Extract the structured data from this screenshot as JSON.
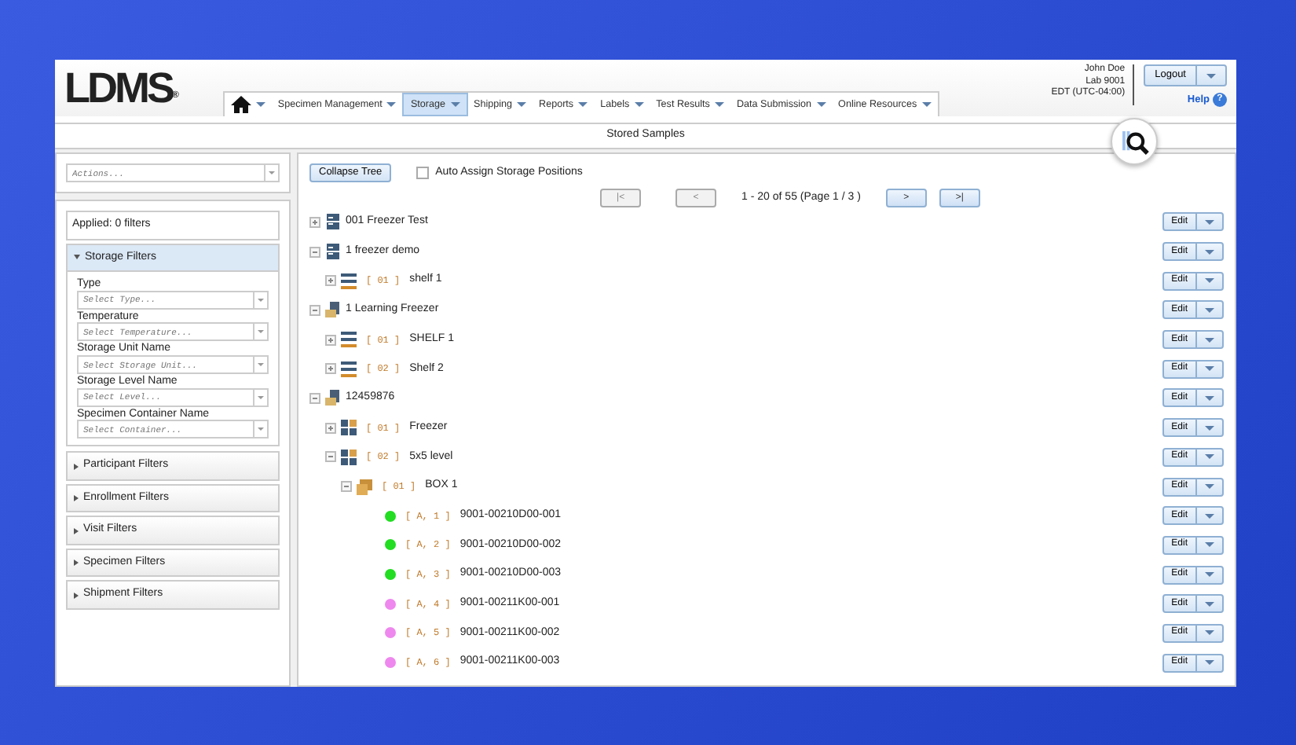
{
  "logo": {
    "text": "LDMS",
    "mark": "®"
  },
  "nav": [
    {
      "kind": "home",
      "selected": false
    },
    {
      "label": "Specimen Management",
      "kind": "menu",
      "selected": false
    },
    {
      "label": "Storage",
      "kind": "menu",
      "selected": true
    },
    {
      "label": "Shipping",
      "kind": "menu",
      "selected": false
    },
    {
      "label": "Reports",
      "kind": "menu",
      "selected": false
    },
    {
      "label": "Labels",
      "kind": "menu",
      "selected": false
    },
    {
      "label": "Test Results",
      "kind": "menu",
      "selected": false
    },
    {
      "label": "Data Submission",
      "kind": "menu",
      "selected": false
    },
    {
      "label": "Online Resources",
      "kind": "menu",
      "selected": false
    }
  ],
  "user": {
    "name": "John Doe",
    "lab": "Lab 9001",
    "timezone": "EDT (UTC-04:00)",
    "logout": "Logout",
    "help": "Help",
    "help_icon": "?"
  },
  "page_title": "Stored Samples",
  "sidebar": {
    "actions_placeholder": "Actions...",
    "applied": "Applied: 0 filters",
    "sections": [
      {
        "title": "Storage Filters",
        "expanded": true,
        "fields": [
          {
            "label": "Type",
            "placeholder": "Select Type..."
          },
          {
            "label": "Temperature",
            "placeholder": "Select Temperature..."
          },
          {
            "label": "Storage Unit Name",
            "placeholder": "Select Storage Unit..."
          },
          {
            "label": "Storage Level Name",
            "placeholder": "Select Level..."
          },
          {
            "label": "Specimen Container Name",
            "placeholder": "Select Container..."
          }
        ]
      },
      {
        "title": "Participant Filters",
        "expanded": false
      },
      {
        "title": "Enrollment Filters",
        "expanded": false
      },
      {
        "title": "Visit Filters",
        "expanded": false
      },
      {
        "title": "Specimen Filters",
        "expanded": false
      },
      {
        "title": "Shipment Filters",
        "expanded": false
      }
    ]
  },
  "toolbar": {
    "collapse_button": "Collapse Tree",
    "auto_assign": {
      "label": "Auto Assign Storage Positions",
      "checked": false
    }
  },
  "pager": {
    "buttons": [
      {
        "label": "|<",
        "disabled": true
      },
      {
        "label": "<",
        "disabled": true
      },
      {
        "label": ">",
        "disabled": false
      },
      {
        "label": ">|",
        "disabled": false
      }
    ],
    "summary": "1 - 20  of  55  (Page  1  / 3 )"
  },
  "tree": [
    {
      "kind": "freezer",
      "name": "001 Freezer Test",
      "expanded": false,
      "edit": "Edit"
    },
    {
      "kind": "freezer",
      "name": "1 freezer demo",
      "expanded": true,
      "edit": "Edit",
      "children": [
        {
          "kind": "shelf",
          "position": "[ 01 ]",
          "name": "shelf 1",
          "expanded": false,
          "edit": "Edit"
        }
      ]
    },
    {
      "kind": "unit",
      "name": "1 Learning Freezer",
      "expanded": true,
      "edit": "Edit",
      "children": [
        {
          "kind": "shelf",
          "position": "[ 01 ]",
          "name": "SHELF 1",
          "expanded": false,
          "edit": "Edit"
        },
        {
          "kind": "shelf",
          "position": "[ 02 ]",
          "name": "Shelf 2",
          "expanded": false,
          "edit": "Edit"
        }
      ]
    },
    {
      "kind": "unit",
      "name": "12459876",
      "expanded": true,
      "edit": "Edit",
      "children": [
        {
          "kind": "rack",
          "position": "[ 01 ]",
          "name": "Freezer",
          "expanded": false,
          "edit": "Edit"
        },
        {
          "kind": "rack",
          "position": "[ 02 ]",
          "name": "5x5 level",
          "expanded": true,
          "edit": "Edit",
          "children": [
            {
              "kind": "box",
              "position": "[ 01 ]",
              "name": "BOX 1",
              "expanded": true,
              "edit": "Edit",
              "children": [
                {
                  "kind": "sample",
                  "position": "[ A, 1 ]",
                  "name": "9001-00210D00-001",
                  "color": "#22dd22",
                  "edit": "Edit"
                },
                {
                  "kind": "sample",
                  "position": "[ A, 2 ]",
                  "name": "9001-00210D00-002",
                  "color": "#22dd22",
                  "edit": "Edit"
                },
                {
                  "kind": "sample",
                  "position": "[ A, 3 ]",
                  "name": "9001-00210D00-003",
                  "color": "#22dd22",
                  "edit": "Edit"
                },
                {
                  "kind": "sample",
                  "position": "[ A, 4 ]",
                  "name": "9001-00211K00-001",
                  "color": "#ee88ee",
                  "edit": "Edit"
                },
                {
                  "kind": "sample",
                  "position": "[ A, 5 ]",
                  "name": "9001-00211K00-002",
                  "color": "#ee88ee",
                  "edit": "Edit"
                },
                {
                  "kind": "sample",
                  "position": "[ A, 6 ]",
                  "name": "9001-00211K00-003",
                  "color": "#ee88ee",
                  "edit": "Edit"
                }
              ]
            }
          ]
        }
      ]
    }
  ]
}
